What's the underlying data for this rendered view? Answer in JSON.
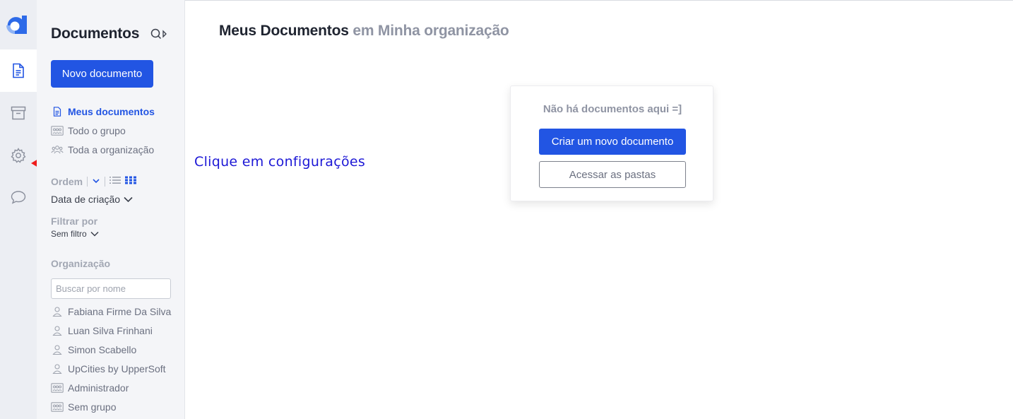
{
  "sidebar": {
    "title": "Documentos",
    "new_document_label": "Novo documento",
    "menu": [
      {
        "label": "Meus documentos",
        "icon": "document-icon",
        "active": true
      },
      {
        "label": "Todo o grupo",
        "icon": "group-icon",
        "active": false
      },
      {
        "label": "Toda a organização",
        "icon": "people-icon",
        "active": false
      }
    ],
    "order_label": "Ordem",
    "order_value": "Data de criação",
    "filter_label": "Filtrar por",
    "filter_value": "Sem filtro",
    "organization_label": "Organização",
    "search_placeholder": "Buscar por nome",
    "members": [
      {
        "label": "Fabiana Firme Da Silva",
        "icon": "user-icon"
      },
      {
        "label": "Luan Silva Frinhani",
        "icon": "user-icon"
      },
      {
        "label": "Simon Scabello",
        "icon": "user-icon"
      },
      {
        "label": "UpCities by UpperSoft",
        "icon": "user-icon"
      },
      {
        "label": "Administrador",
        "icon": "group-icon"
      },
      {
        "label": "Sem grupo",
        "icon": "group-icon"
      }
    ]
  },
  "main": {
    "title": "Meus Documentos",
    "title_context": "em Minha organização",
    "empty_message": "Não há documentos aqui =]",
    "create_label": "Criar um novo documento",
    "folders_label": "Acessar as pastas"
  },
  "annotation": {
    "text": "Clique em configurações",
    "color": "#1d18d6",
    "arrow_color": "#ee1c1c"
  },
  "colors": {
    "accent": "#2255e3",
    "rail_bg": "#eceef3",
    "sidebar_bg": "#f4f5f8"
  }
}
